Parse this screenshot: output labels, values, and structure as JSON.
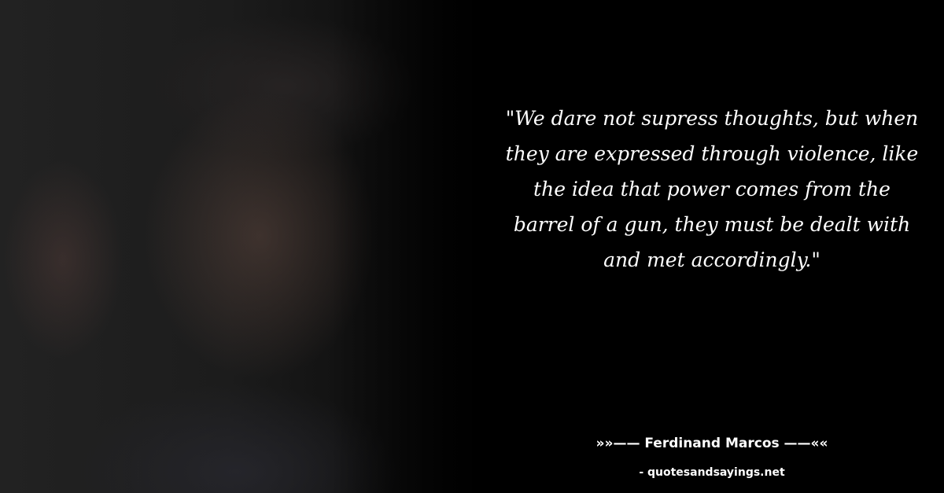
{
  "quote": {
    "text": "\"We dare not supress thoughts, but when they are expressed through violence, like the idea that power comes from the barrel of a gun, they must be dealt with and met accordingly.\""
  },
  "author": {
    "line": "»»—— Ferdinand Marcos ——««"
  },
  "source": {
    "text": "- quotesandsayings.net"
  },
  "colors": {
    "background": "#000000",
    "text": "#ffffff"
  }
}
